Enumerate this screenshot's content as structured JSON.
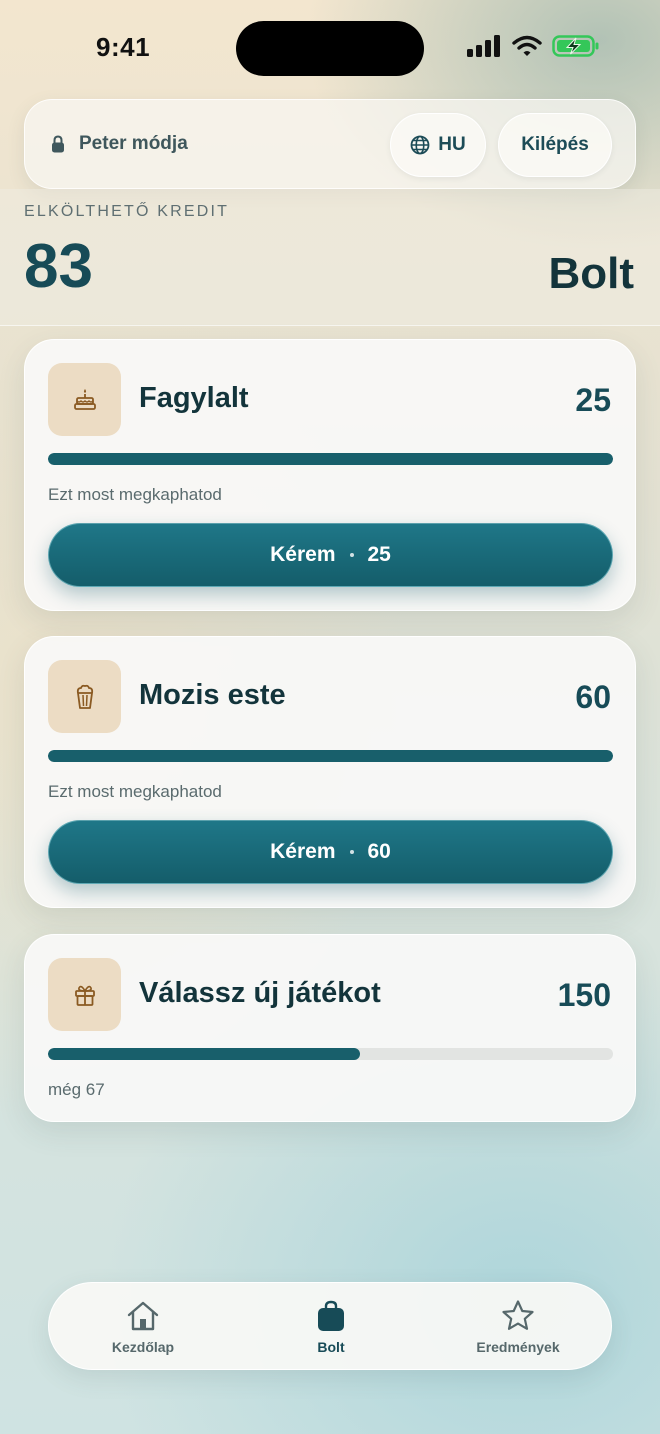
{
  "status_bar": {
    "time": "9:41"
  },
  "header": {
    "mode_label": "Peter módja",
    "language_label": "HU",
    "logout_label": "Kilépés"
  },
  "credit": {
    "caption": "ELKÖLTHETŐ KREDIT",
    "value": "83",
    "page_title": "Bolt"
  },
  "rewards": [
    {
      "title": "Fagylalt",
      "price": "25",
      "progress": 1.0,
      "status": "Ezt most megkaphatod",
      "button_label": "Kérem",
      "button_price": "25",
      "icon": "cake-icon"
    },
    {
      "title": "Mozis este",
      "price": "60",
      "progress": 1.0,
      "status": "Ezt most megkaphatod",
      "button_label": "Kérem",
      "button_price": "60",
      "icon": "popcorn-icon"
    },
    {
      "title": "Válassz új játékot",
      "price": "150",
      "progress": 0.553,
      "status": "még 67",
      "icon": "gift-icon"
    }
  ],
  "nav": {
    "home_label": "Kezdőlap",
    "shop_label": "Bolt",
    "achievements_label": "Eredmények",
    "active": "shop"
  },
  "colors": {
    "accent": "#185f6b",
    "button": "#1a6b7a",
    "icon_tile": "#ecdcc4",
    "icon_stroke": "#8a5a22",
    "battery": "#34c759"
  }
}
